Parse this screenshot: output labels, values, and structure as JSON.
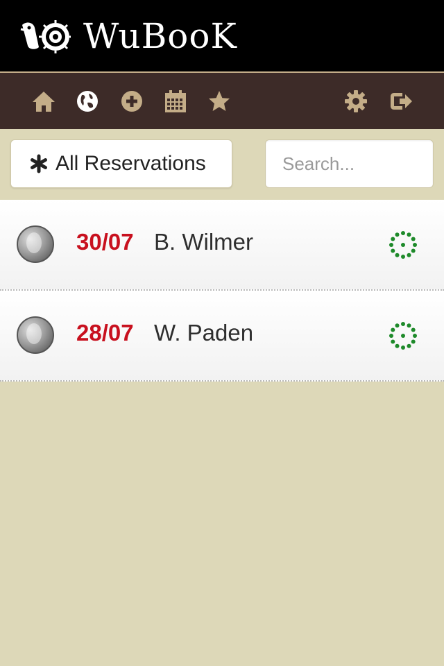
{
  "app": {
    "title": "WuBooK"
  },
  "nav": {
    "icons": [
      "home-icon",
      "globe-icon",
      "add-icon",
      "calendar-icon",
      "star-icon",
      "gear-icon",
      "logout-icon"
    ],
    "icon_color": "#c4ad88"
  },
  "filter": {
    "label": "All Reservations",
    "icon": "asterisk-icon"
  },
  "search": {
    "placeholder": "Search..."
  },
  "reservations": [
    {
      "date": "30/07",
      "name": "B. Wilmer",
      "status_icon": "status-ring-icon"
    },
    {
      "date": "28/07",
      "name": "W. Paden",
      "status_icon": "status-ring-icon"
    }
  ],
  "colors": {
    "date": "#c8101e",
    "status": "#1e8a2a",
    "navbar": "#3d2b28",
    "background": "#ddd8b8"
  }
}
